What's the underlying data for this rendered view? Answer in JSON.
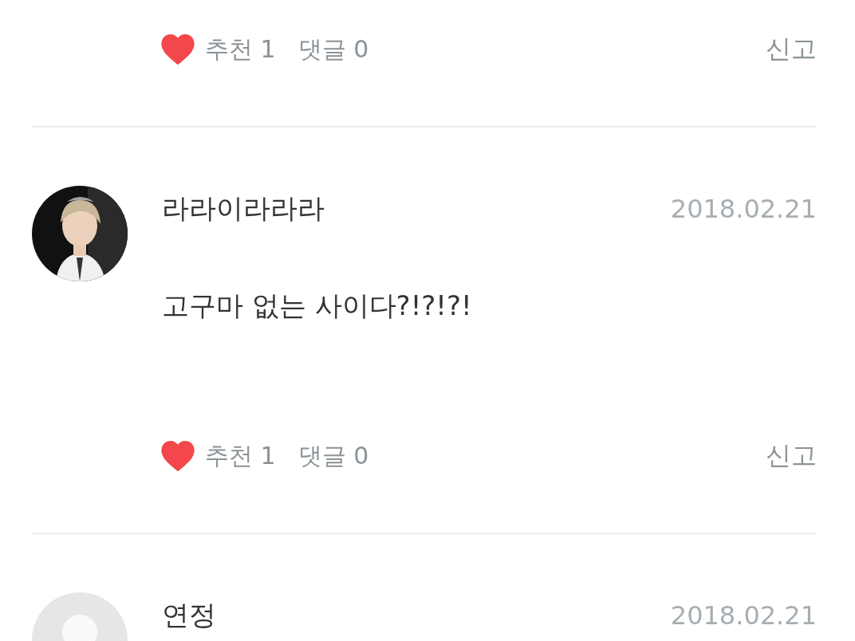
{
  "comments": [
    {
      "liked": true,
      "likes": "추천 1",
      "replies": "댓글 0",
      "report": "신고"
    },
    {
      "author": "라라이라라라",
      "date": "2018.02.21",
      "text": "고구마 없는 사이다?!?!?!",
      "liked": true,
      "likes": "추천 1",
      "replies": "댓글 0",
      "report": "신고"
    },
    {
      "avatar": {
        "kind": "default"
      },
      "author": "연정",
      "date": "2018.02.21"
    }
  ]
}
